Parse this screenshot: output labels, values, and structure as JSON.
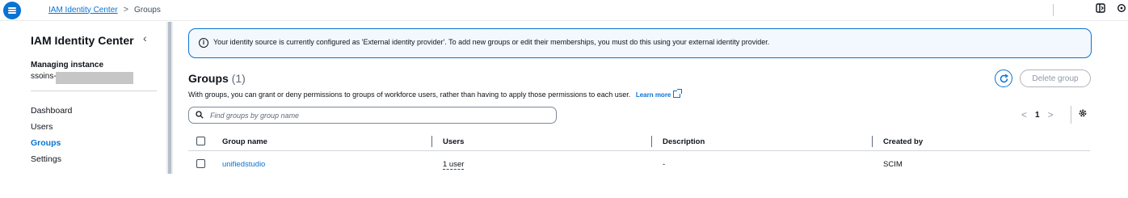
{
  "breadcrumb": {
    "root": "IAM Identity Center",
    "current": "Groups"
  },
  "sidebar": {
    "title": "IAM Identity Center",
    "instance_label": "Managing instance",
    "instance_value_prefix": "ssoins-",
    "nav": [
      "Dashboard",
      "Users",
      "Groups",
      "Settings"
    ],
    "active_item": "Groups"
  },
  "banner": {
    "icon": "info-icon",
    "text": "Your identity source is currently configured as 'External identity provider'. To add new groups or edit their memberships, you must do this using your external identity provider."
  },
  "groups": {
    "title": "Groups",
    "count": "(1)",
    "description": "With groups, you can grant or deny permissions to groups of workforce users, rather than having to apply those permissions to each user.",
    "learn_more": "Learn more",
    "delete_label": "Delete group"
  },
  "search": {
    "placeholder": "Find groups by group name",
    "value": ""
  },
  "pagination": {
    "page": "1"
  },
  "table": {
    "columns": [
      "Group name",
      "Users",
      "Description",
      "Created by"
    ],
    "rows": [
      {
        "group_name": "unifiedstudio",
        "users": "1 user",
        "description": "-",
        "created_by": "SCIM"
      }
    ]
  },
  "colors": {
    "accent": "#0972d3",
    "text": "#0f141a",
    "muted": "#5f6b7a",
    "banner_bg": "#f2f8fd"
  }
}
